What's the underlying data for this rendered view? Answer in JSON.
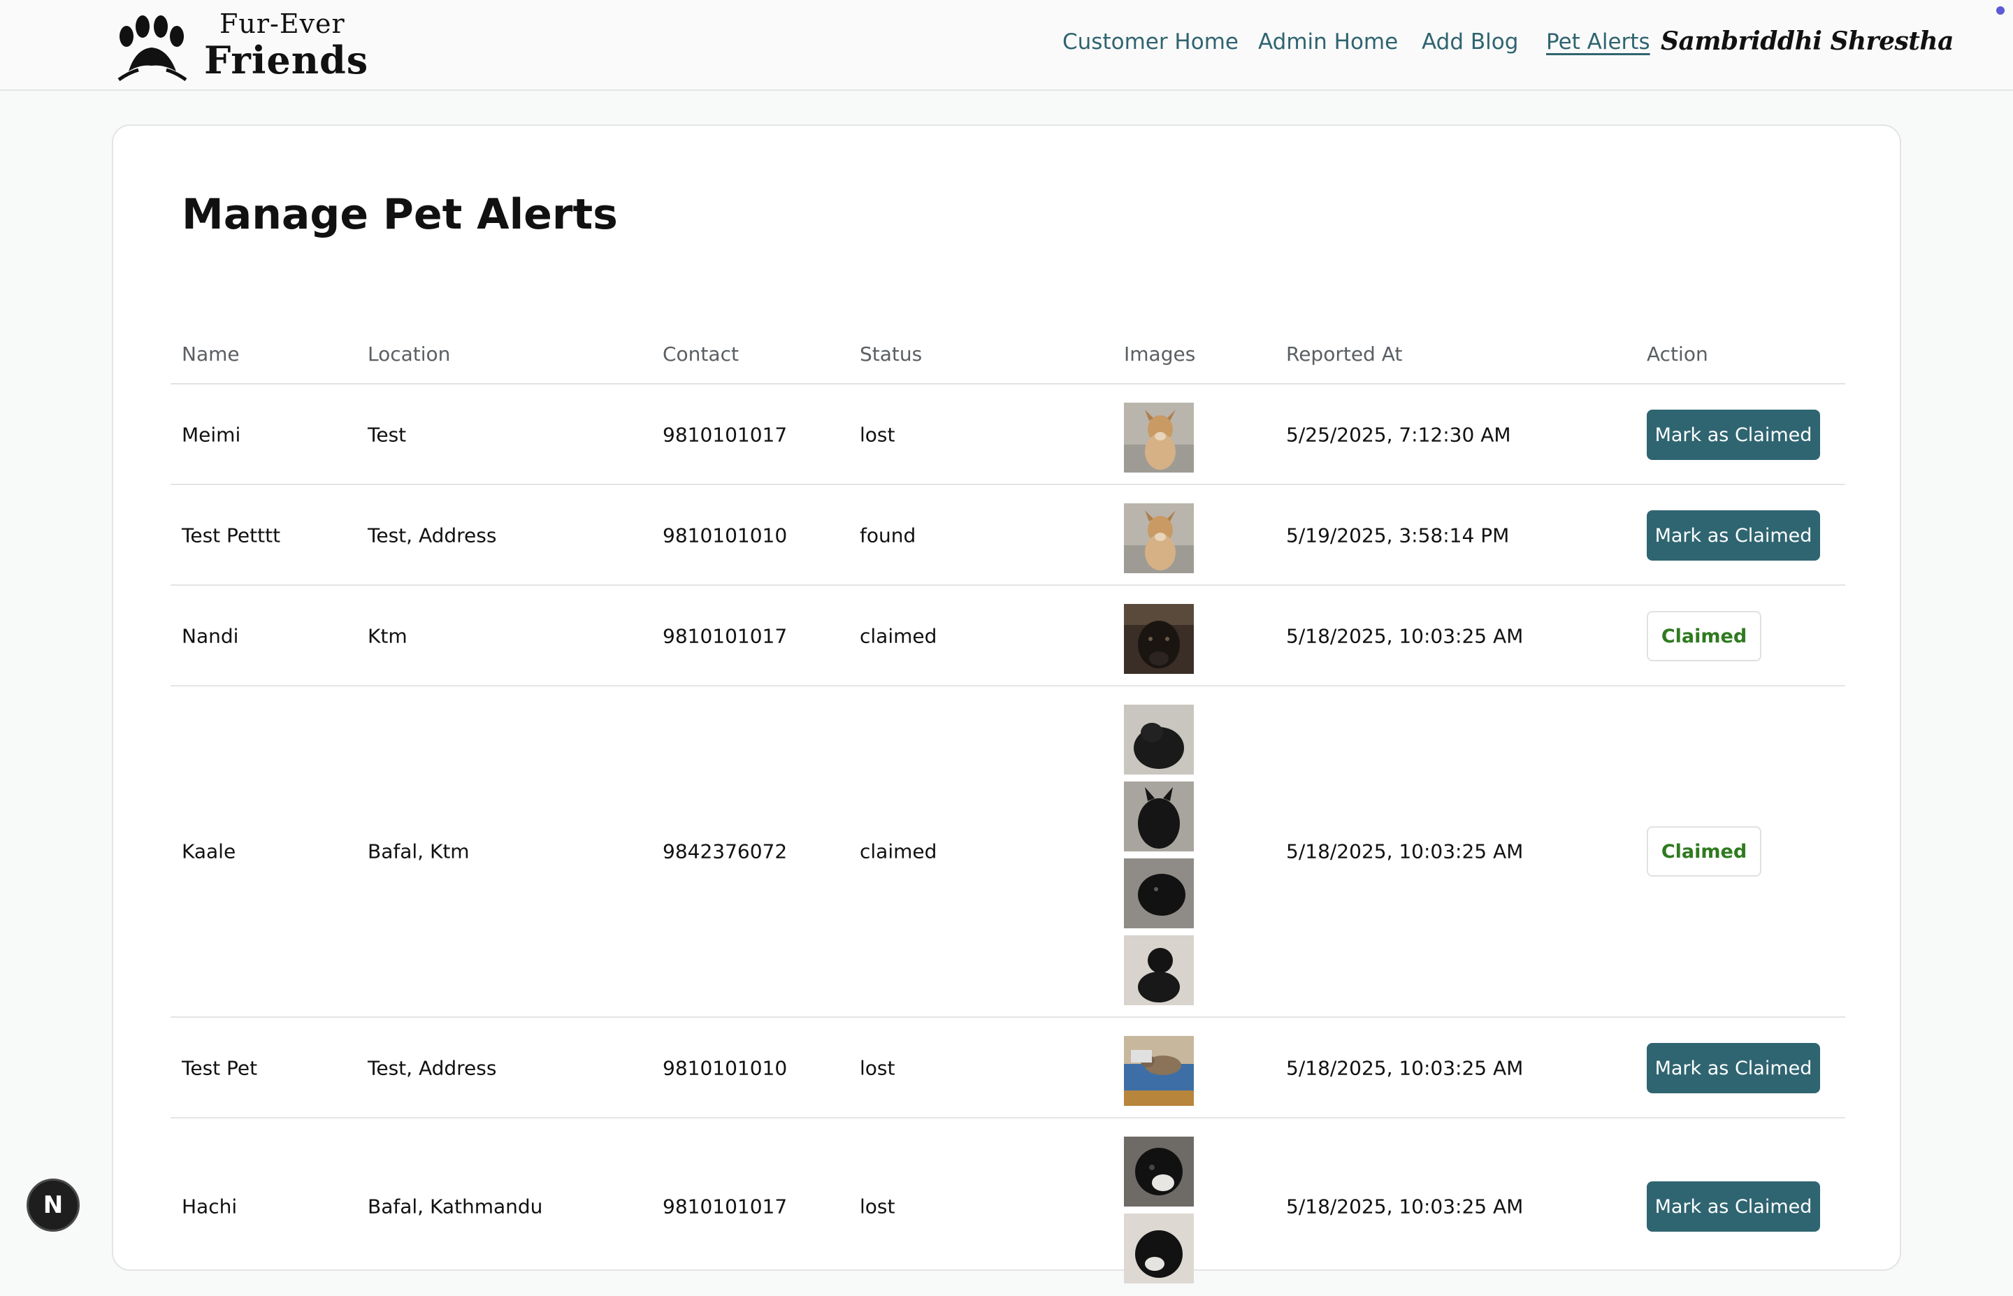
{
  "brand": {
    "line1": "Fur-Ever",
    "line2": "Friends",
    "logo_icon": "paw-print-icon"
  },
  "nav": {
    "links": [
      {
        "label": "Customer Home",
        "active": false
      },
      {
        "label": "Admin Home",
        "active": false
      },
      {
        "label": "Add Blog",
        "active": false
      },
      {
        "label": "Pet Alerts",
        "active": true
      }
    ],
    "user": "Sambriddhi Shrestha"
  },
  "page": {
    "title": "Manage Pet Alerts"
  },
  "table": {
    "headers": {
      "name": "Name",
      "location": "Location",
      "contact": "Contact",
      "status": "Status",
      "images": "Images",
      "reported_at": "Reported At",
      "action": "Action"
    },
    "rows": [
      {
        "name": "Meimi",
        "location": "Test",
        "contact": "9810101017",
        "status": "lost",
        "reported_at": "5/25/2025, 7:12:30 AM",
        "action": "Mark as Claimed",
        "claimed": false,
        "images": [
          "tan-dog-photo"
        ]
      },
      {
        "name": "Test Petttt",
        "location": "Test, Address",
        "contact": "9810101010",
        "status": "found",
        "reported_at": "5/19/2025, 3:58:14 PM",
        "action": "Mark as Claimed",
        "claimed": false,
        "images": [
          "tan-dog-photo"
        ]
      },
      {
        "name": "Nandi",
        "location": "Ktm",
        "contact": "9810101017",
        "status": "claimed",
        "reported_at": "5/18/2025, 10:03:25 AM",
        "action": "Claimed",
        "claimed": true,
        "images": [
          "dark-calf-photo"
        ]
      },
      {
        "name": "Kaale",
        "location": "Bafal, Ktm",
        "contact": "9842376072",
        "status": "claimed",
        "reported_at": "5/18/2025, 10:03:25 AM",
        "action": "Claimed",
        "claimed": true,
        "images": [
          "black-dog-photo",
          "black-dog-photo",
          "black-dog-photo",
          "black-dog-photo"
        ]
      },
      {
        "name": "Test Pet",
        "location": "Test, Address",
        "contact": "9810101010",
        "status": "lost",
        "reported_at": "5/18/2025, 10:03:25 AM",
        "action": "Mark as Claimed",
        "claimed": false,
        "images": [
          "cat-on-blanket-photo"
        ]
      },
      {
        "name": "Hachi",
        "location": "Bafal, Kathmandu",
        "contact": "9810101017",
        "status": "lost",
        "reported_at": "5/18/2025, 10:03:25 AM",
        "action": "Mark as Claimed",
        "claimed": false,
        "images": [
          "black-white-dog-photo",
          "black-white-dog-photo"
        ]
      }
    ]
  },
  "floating": {
    "next_badge": "N"
  },
  "colors": {
    "accent": "#2f6571",
    "nav_link": "#2f6470",
    "claimed_text": "#2f7a1f"
  }
}
